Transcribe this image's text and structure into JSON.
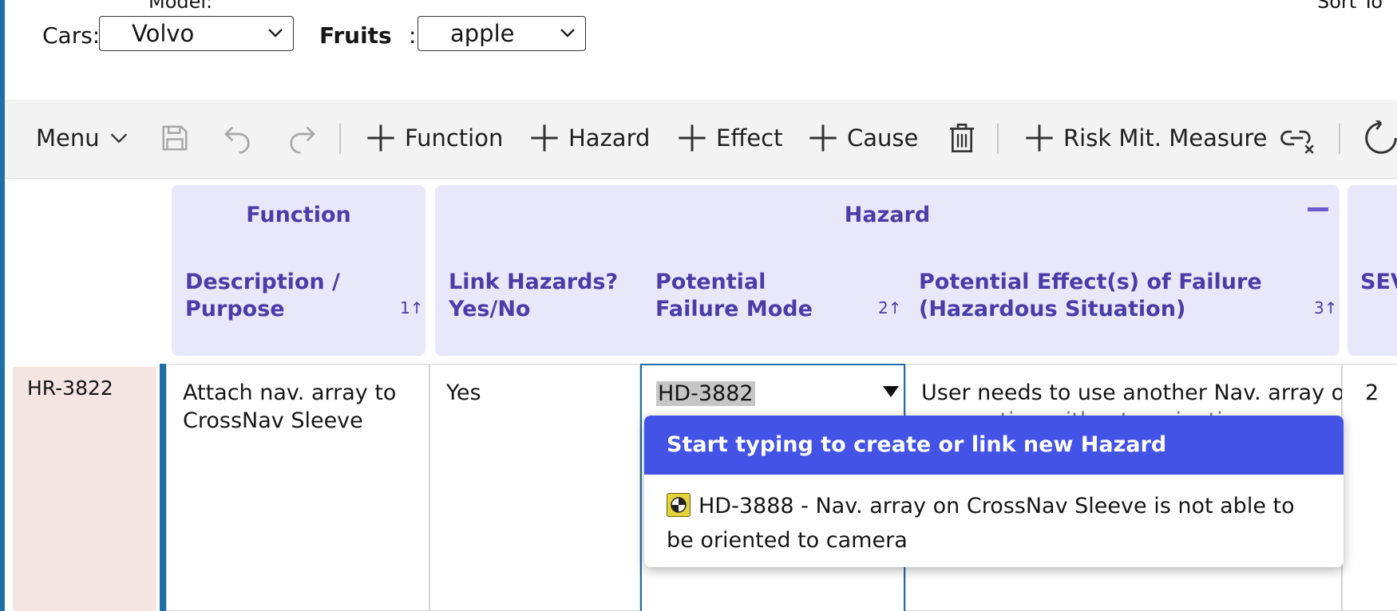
{
  "top_cut": {
    "left_text": "Model:",
    "right_text": "Sort To"
  },
  "filters": {
    "cars_label": "Cars:",
    "cars_value": "Volvo",
    "fruits_label": "Fruits",
    "fruits_colon": ":",
    "fruits_value": "apple"
  },
  "toolbar": {
    "menu_label": "Menu",
    "add_function": "Function",
    "add_hazard": "Hazard",
    "add_effect": "Effect",
    "add_cause": "Cause",
    "add_risk_mit": "Risk Mit. Measure"
  },
  "groups": {
    "function": {
      "title": "Function",
      "columns": [
        {
          "label": "Description / Purpose",
          "sort": "1↑"
        }
      ]
    },
    "hazard": {
      "title": "Hazard",
      "columns": [
        {
          "label": "Link Hazards? Yes/No",
          "sort": ""
        },
        {
          "label": "Potential Failure Mode",
          "sort": "2↑"
        },
        {
          "label": "Potential Effect(s) of Failure (Hazardous Situation)",
          "sort": "3↑"
        }
      ]
    },
    "next": {
      "column_label": "SEV"
    }
  },
  "row": {
    "id": "HR-3822",
    "description": "Attach nav. array to CrossNav Sleeve",
    "link_hazards": "Yes",
    "failure_mode": "HD-3882",
    "effect_line1": "User needs to use another Nav. array or",
    "effect_line2": "nav. option without navigation",
    "severity": "2"
  },
  "dropdown": {
    "header": "Start typing to create or link new Hazard",
    "items": [
      {
        "icon": "hazard-icon",
        "text": "HD-3888 - Nav. array on CrossNav Sleeve is not able to be oriented to camera"
      }
    ]
  },
  "colors": {
    "accent_blue": "#1f6fa8",
    "header_purple": "#4a3da8",
    "header_bg": "#e8e8fa",
    "popup_header_bg": "#4353e6",
    "row_id_bg": "#f4e4e2"
  }
}
